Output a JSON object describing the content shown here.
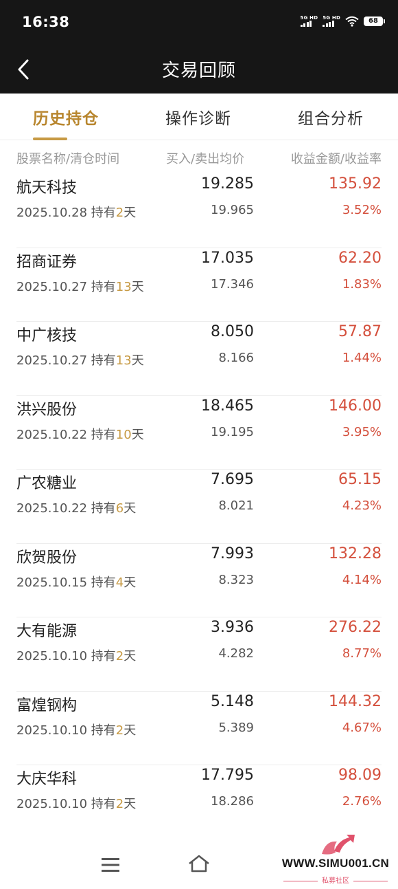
{
  "status_bar": {
    "time": "16:38",
    "signal1_label": "5G HD",
    "signal2_label": "5G HD",
    "battery": "68",
    "icons": [
      "signal-icon",
      "wifi-icon",
      "battery-icon"
    ]
  },
  "nav": {
    "title": "交易回顾",
    "back_icon": "chevron-left-icon"
  },
  "tabs": [
    {
      "label": "历史持仓",
      "active": true
    },
    {
      "label": "操作诊断",
      "active": false
    },
    {
      "label": "组合分析",
      "active": false
    }
  ],
  "columns": {
    "name_date": "股票名称/清仓时间",
    "prices": "买入/卖出均价",
    "profit": "收益金额/收益率"
  },
  "hold_prefix": "持有",
  "hold_suffix": "天",
  "rows": [
    {
      "name": "航天科技",
      "date": "2025.10.28",
      "days": "2",
      "buy": "19.285",
      "sell": "19.965",
      "profit": "135.92",
      "rate": "3.52%"
    },
    {
      "name": "招商证券",
      "date": "2025.10.27",
      "days": "13",
      "buy": "17.035",
      "sell": "17.346",
      "profit": "62.20",
      "rate": "1.83%"
    },
    {
      "name": "中广核技",
      "date": "2025.10.27",
      "days": "13",
      "buy": "8.050",
      "sell": "8.166",
      "profit": "57.87",
      "rate": "1.44%"
    },
    {
      "name": "洪兴股份",
      "date": "2025.10.22",
      "days": "10",
      "buy": "18.465",
      "sell": "19.195",
      "profit": "146.00",
      "rate": "3.95%"
    },
    {
      "name": "广农糖业",
      "date": "2025.10.22",
      "days": "6",
      "buy": "7.695",
      "sell": "8.021",
      "profit": "65.15",
      "rate": "4.23%"
    },
    {
      "name": "欣贺股份",
      "date": "2025.10.15",
      "days": "4",
      "buy": "7.993",
      "sell": "8.323",
      "profit": "132.28",
      "rate": "4.14%"
    },
    {
      "name": "大有能源",
      "date": "2025.10.10",
      "days": "2",
      "buy": "3.936",
      "sell": "4.282",
      "profit": "276.22",
      "rate": "8.77%"
    },
    {
      "name": "富煌钢构",
      "date": "2025.10.10",
      "days": "2",
      "buy": "5.148",
      "sell": "5.389",
      "profit": "144.32",
      "rate": "4.67%"
    },
    {
      "name": "大庆华科",
      "date": "2025.10.10",
      "days": "2",
      "buy": "17.795",
      "sell": "18.286",
      "profit": "98.09",
      "rate": "2.76%"
    }
  ],
  "bottom_nav": {
    "icons": [
      "menu-icon",
      "home-icon"
    ]
  },
  "watermark": {
    "text": "WWW.SIMU001.CN",
    "sub": "私募社区"
  },
  "colors": {
    "accent": "#c79a44",
    "profit": "#d4503d",
    "header_bg": "#161616"
  }
}
